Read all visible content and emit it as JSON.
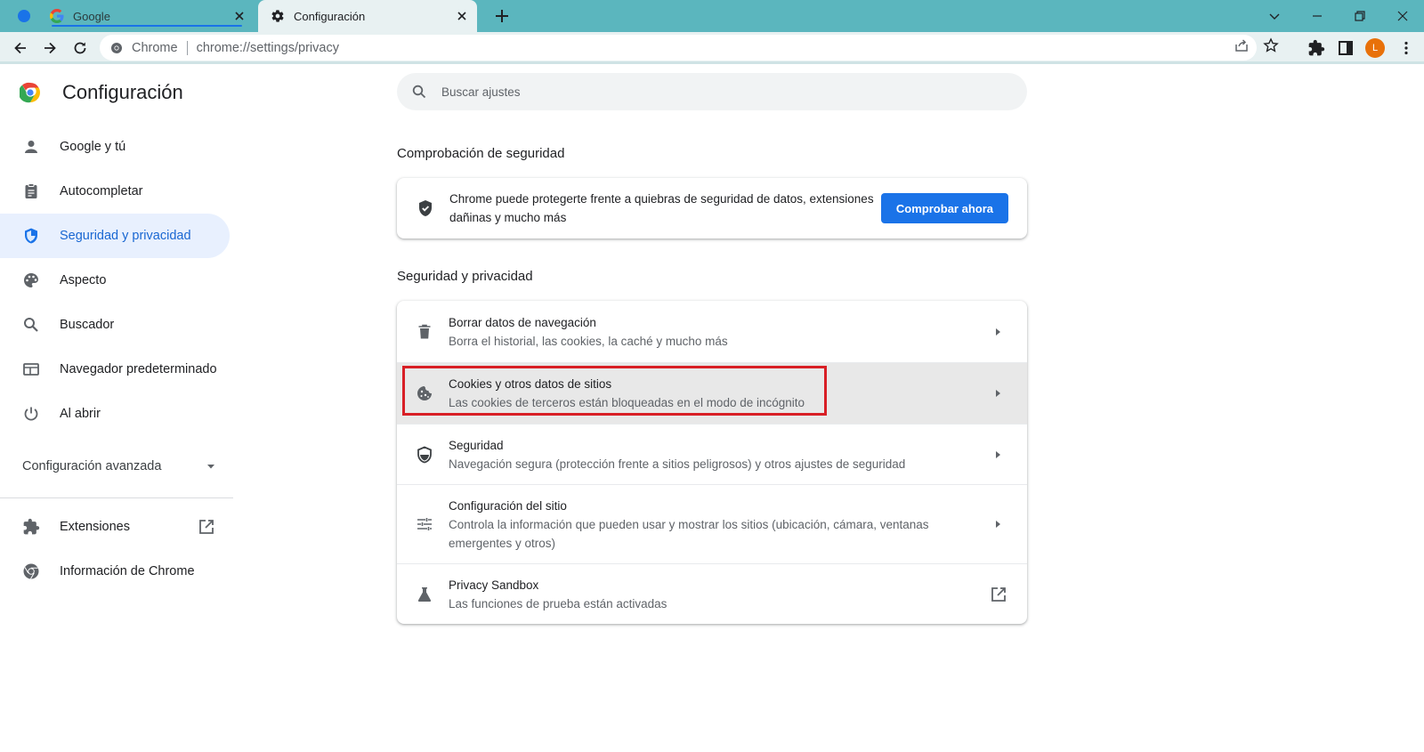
{
  "tabs": [
    {
      "title": "Google",
      "favicon": "google-g-icon"
    },
    {
      "title": "Configuración",
      "favicon": "gear-icon"
    }
  ],
  "toolbar": {
    "omnibox_site_label": "Chrome",
    "omnibox_url": "chrome://settings/privacy",
    "avatar_letter": "L"
  },
  "sidebar": {
    "title": "Configuración",
    "items": [
      {
        "label": "Google y tú",
        "icon": "person-icon"
      },
      {
        "label": "Autocompletar",
        "icon": "clipboard-icon"
      },
      {
        "label": "Seguridad y privacidad",
        "icon": "shield-icon",
        "active": true
      },
      {
        "label": "Aspecto",
        "icon": "palette-icon"
      },
      {
        "label": "Buscador",
        "icon": "search-icon"
      },
      {
        "label": "Navegador predeterminado",
        "icon": "browser-icon"
      },
      {
        "label": "Al abrir",
        "icon": "power-icon"
      }
    ],
    "advanced_label": "Configuración avanzada",
    "extra_items": [
      {
        "label": "Extensiones",
        "icon": "puzzle-icon"
      },
      {
        "label": "Información de Chrome",
        "icon": "chrome-icon"
      }
    ]
  },
  "search": {
    "placeholder": "Buscar ajustes"
  },
  "safety_check": {
    "heading": "Comprobación de seguridad",
    "text": "Chrome puede protegerte frente a quiebras de seguridad de datos, extensiones dañinas y mucho más",
    "button": "Comprobar ahora"
  },
  "privacy": {
    "heading": "Seguridad y privacidad",
    "rows": [
      {
        "title": "Borrar datos de navegación",
        "subtitle": "Borra el historial, las cookies, la caché y mucho más",
        "icon": "trash-icon"
      },
      {
        "title": "Cookies y otros datos de sitios",
        "subtitle": "Las cookies de terceros están bloqueadas en el modo de incógnito",
        "icon": "cookie-icon"
      },
      {
        "title": "Seguridad",
        "subtitle": "Navegación segura (protección frente a sitios peligrosos) y otros ajustes de seguridad",
        "icon": "shield-icon"
      },
      {
        "title": "Configuración del sitio",
        "subtitle": "Controla la información que pueden usar y mostrar los sitios (ubicación, cámara, ventanas emergentes y otros)",
        "icon": "sliders-icon"
      },
      {
        "title": "Privacy Sandbox",
        "subtitle": "Las funciones de prueba están activadas",
        "icon": "flask-icon"
      }
    ]
  },
  "colors": {
    "accent": "#1a73e8",
    "active_bg": "#e8f0fe",
    "tabstrip": "#5bb6be",
    "highlight_box": "#d81f26"
  }
}
